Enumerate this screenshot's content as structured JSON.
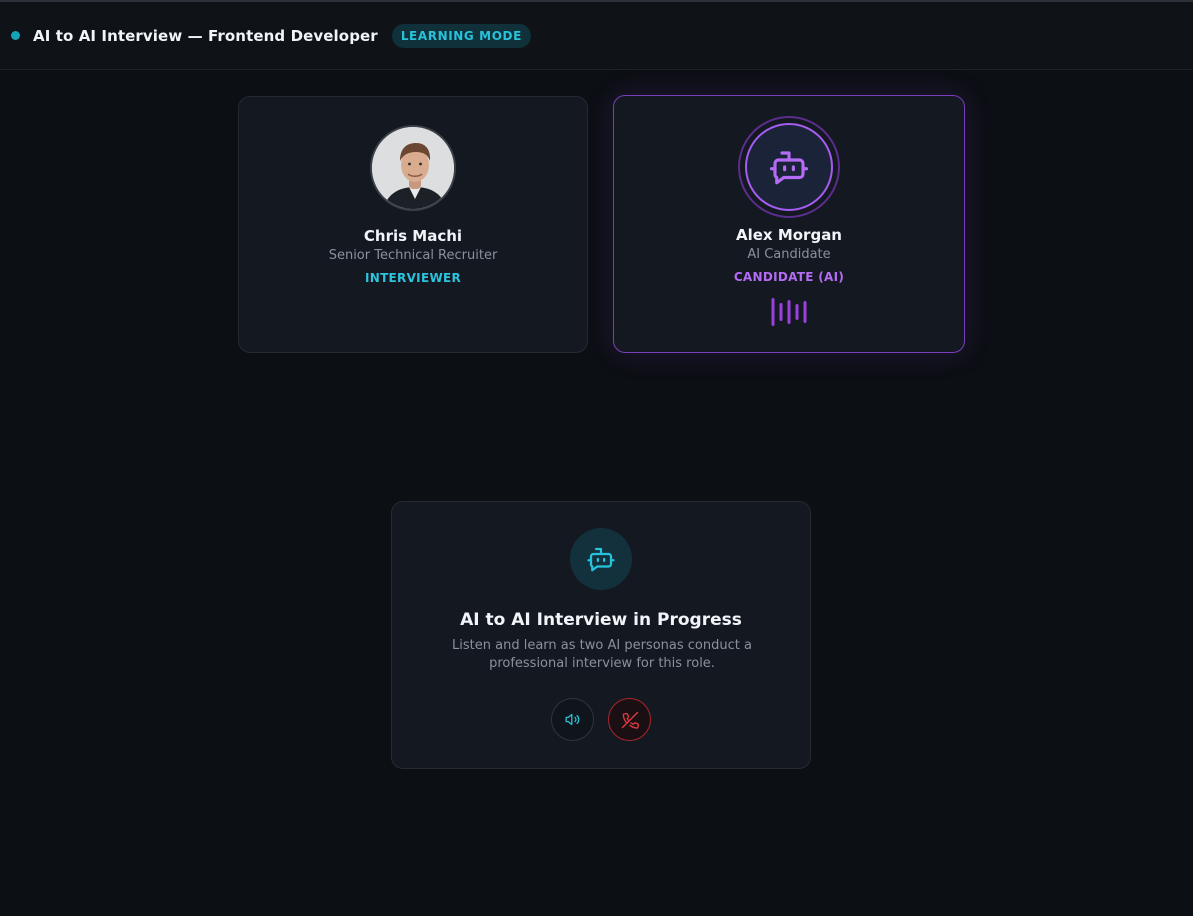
{
  "header": {
    "title": "AI to AI Interview — Frontend Developer",
    "badge": "LEARNING MODE"
  },
  "interviewer": {
    "name": "Chris Machi",
    "role": "Senior Technical Recruiter",
    "tag": "INTERVIEWER"
  },
  "candidate": {
    "name": "Alex Morgan",
    "role": "AI Candidate",
    "tag": "CANDIDATE (AI)",
    "icon": "robot-chat-icon"
  },
  "status": {
    "title": "AI to AI Interview in Progress",
    "description": "Listen and learn as two AI personas conduct a professional interview for this role.",
    "icon": "robot-chat-icon"
  },
  "controls": {
    "speaker_icon": "speaker-icon",
    "end_call_icon": "phone-off-icon"
  },
  "colors": {
    "accent_cyan": "#27c2dc",
    "accent_purple": "#a55cf0",
    "danger": "#d9353c",
    "background": "#0c0f14"
  }
}
